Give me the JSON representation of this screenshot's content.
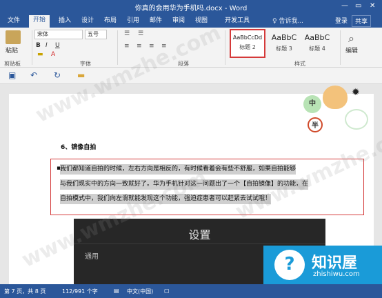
{
  "window": {
    "title": "你真的会用华为手机吗.docx - Word",
    "minimize": "—",
    "restore": "▭",
    "close": "✕"
  },
  "ribbon_tabs": [
    "文件",
    "开始",
    "插入",
    "设计",
    "布局",
    "引用",
    "邮件",
    "审阅",
    "视图",
    "开发工具"
  ],
  "tell_me": "♀ 告诉我...",
  "login": "登录",
  "share": "共享",
  "ribbon": {
    "paste": "粘贴",
    "clipboard_label": "剪贴板",
    "font_name": "宋体",
    "font_size": "五号",
    "font_label": "字体",
    "paragraph_label": "段落",
    "styles_label": "样式",
    "editing": "编辑",
    "bold": "B",
    "italic": "I",
    "underline": "U",
    "styles": [
      {
        "preview": "AaBbCcDd",
        "name": "标题 2"
      },
      {
        "preview": "AaBbC",
        "name": "标题 3"
      },
      {
        "preview": "AaBbC",
        "name": "标题 4"
      }
    ]
  },
  "qat": {
    "save_icon": "save-icon",
    "undo_icon": "undo-icon",
    "redo_icon": "redo-icon",
    "open_icon": "folder-icon"
  },
  "document": {
    "heading": "6、镜像自拍",
    "lines": [
      "我们都知道自拍的时候，左右方向是相反的，有时候看着会有些不舒服，如果自拍能够",
      "与我们现实中的方向一致就好了。华为手机针对这一问题出了一个【自拍镜像】的功能，在",
      "自拍模式中，我们向左滑就能发现这个功能，强迫症患者可以赶紧去试试哦！"
    ],
    "screenshot_title": "设置",
    "screenshot_label": "通用"
  },
  "mascot": {
    "bubble1": "中",
    "bubble2": "半"
  },
  "logo": {
    "name": "知识屋",
    "url": "zhishiwu.com",
    "mark": "?"
  },
  "watermarks": [
    "www.wmzhe.com",
    "www.wmzhe.com",
    "www.wmzhe.com"
  ],
  "status": {
    "page": "第 7 页，共 8 页",
    "words": "112/991 个字",
    "language": "中文(中国)"
  },
  "colors": {
    "accent": "#2b579a",
    "highlight_border": "#d43a3a",
    "logo_bg": "#1a9bd8"
  }
}
